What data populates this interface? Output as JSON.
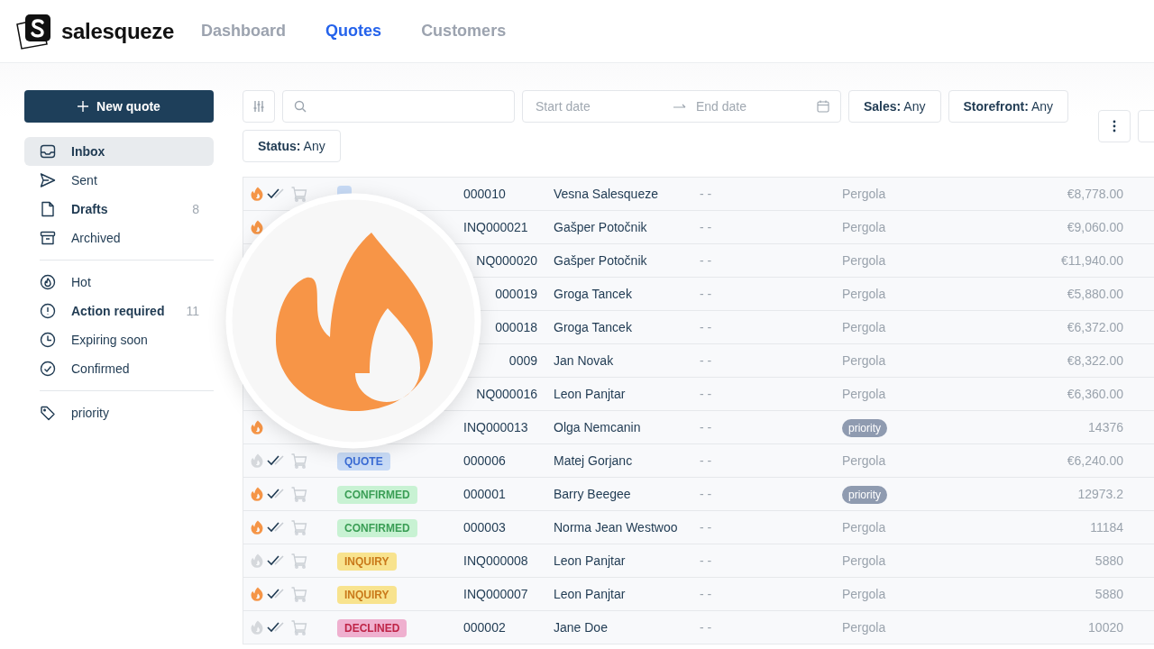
{
  "brand": {
    "name": "salesqueze"
  },
  "nav": [
    {
      "label": "Dashboard",
      "selected": false
    },
    {
      "label": "Quotes",
      "selected": true
    },
    {
      "label": "Customers",
      "selected": false
    }
  ],
  "new_quote_button": "New quote",
  "sidebar": {
    "groups": [
      [
        {
          "kind": "inbox",
          "label": "Inbox",
          "selected": true,
          "bold": true
        },
        {
          "kind": "sent",
          "label": "Sent",
          "selected": false,
          "bold": false
        },
        {
          "kind": "drafts",
          "label": "Drafts",
          "selected": false,
          "bold": true,
          "count": "8"
        },
        {
          "kind": "archive",
          "label": "Archived",
          "selected": false,
          "bold": false
        }
      ],
      [
        {
          "kind": "hot",
          "label": "Hot",
          "selected": false,
          "bold": false
        },
        {
          "kind": "alert",
          "label": "Action required",
          "selected": false,
          "bold": true,
          "count": "11"
        },
        {
          "kind": "clock",
          "label": "Expiring soon",
          "selected": false,
          "bold": false
        },
        {
          "kind": "confirmed",
          "label": "Confirmed",
          "selected": false,
          "bold": false
        }
      ],
      [
        {
          "kind": "tag",
          "label": "priority",
          "selected": false,
          "bold": false
        }
      ]
    ]
  },
  "filters": {
    "start_placeholder": "Start date",
    "end_placeholder": "End date",
    "chips": [
      {
        "label": "Sales:",
        "value": "Any"
      },
      {
        "label": "Storefront:",
        "value": "Any"
      },
      {
        "label": "Status:",
        "value": "Any"
      }
    ]
  },
  "rows": [
    {
      "hot": true,
      "delivered": true,
      "ordered": false,
      "status": {
        "kind": "quote"
      },
      "id": "000010",
      "name": "Vesna Salesqueze",
      "col_5": "- -",
      "product": {
        "kind": "text",
        "label": "Pergola"
      },
      "amount": "€8,778.00"
    },
    {
      "hot": true,
      "id": "INQ000021",
      "name": "Gašper Potočnik",
      "col_5": "- -",
      "product": {
        "kind": "text",
        "label": "Pergola"
      },
      "amount": "€9,060.00"
    },
    {
      "id": "NQ000020",
      "covered": true,
      "name": "Gašper Potočnik",
      "col_5": "- -",
      "product": {
        "kind": "text",
        "label": "Pergola"
      },
      "amount": "€11,940.00"
    },
    {
      "id": "000019",
      "covered": true,
      "name": "Groga Tancek",
      "col_5": "- -",
      "product": {
        "kind": "text",
        "label": "Pergola"
      },
      "amount": "€5,880.00"
    },
    {
      "id": "000018",
      "covered": true,
      "name": "Groga Tancek",
      "col_5": "- -",
      "product": {
        "kind": "text",
        "label": "Pergola"
      },
      "amount": "€6,372.00"
    },
    {
      "id": "0009",
      "covered": true,
      "name": "Jan Novak",
      "col_5": "- -",
      "product": {
        "kind": "text",
        "label": "Pergola"
      },
      "amount": "€8,322.00"
    },
    {
      "id": "NQ000016",
      "covered": true,
      "name": "Leon Panjtar",
      "col_5": "- -",
      "product": {
        "kind": "text",
        "label": "Pergola"
      },
      "amount": "€6,360.00"
    },
    {
      "hot": true,
      "id": "INQ000013",
      "name": "Olga Nemcanin",
      "col_5": "- -",
      "product": {
        "kind": "tag",
        "label": "priority"
      },
      "amount": "14376"
    },
    {
      "hot": false,
      "delivered": true,
      "ordered": false,
      "status": {
        "kind": "quote",
        "label": "QUOTE"
      },
      "id": "000006",
      "name": "Matej Gorjanc",
      "col_5": "- -",
      "product": {
        "kind": "text",
        "label": "Pergola"
      },
      "amount": "€6,240.00"
    },
    {
      "hot": true,
      "delivered": true,
      "ordered": false,
      "status": {
        "kind": "confirmed",
        "label": "CONFIRMED"
      },
      "id": "000001",
      "name": "Barry Beegee",
      "col_5": "- -",
      "product": {
        "kind": "tag",
        "label": "priority"
      },
      "amount": "12973.2"
    },
    {
      "hot": true,
      "delivered": true,
      "ordered": false,
      "status": {
        "kind": "confirmed",
        "label": "CONFIRMED"
      },
      "id": "000003",
      "name": "Norma Jean Westwoo",
      "col_5": "- -",
      "product": {
        "kind": "text",
        "label": "Pergola"
      },
      "amount": "11184"
    },
    {
      "hot": false,
      "delivered": true,
      "ordered": false,
      "status": {
        "kind": "inquiry",
        "label": "INQUIRY"
      },
      "id": "INQ000008",
      "name": "Leon Panjtar",
      "col_5": "- -",
      "product": {
        "kind": "text",
        "label": "Pergola"
      },
      "amount": "5880"
    },
    {
      "hot": true,
      "delivered": true,
      "ordered": false,
      "status": {
        "kind": "inquiry",
        "label": "INQUIRY"
      },
      "id": "INQ000007",
      "name": "Leon Panjtar",
      "col_5": "- -",
      "product": {
        "kind": "text",
        "label": "Pergola"
      },
      "amount": "5880"
    },
    {
      "hot": false,
      "delivered": true,
      "ordered": false,
      "status": {
        "kind": "declined",
        "label": "DECLINED"
      },
      "id": "000002",
      "name": "Jane Doe",
      "col_5": "- -",
      "product": {
        "kind": "text",
        "label": "Pergola"
      },
      "amount": "10020"
    }
  ]
}
